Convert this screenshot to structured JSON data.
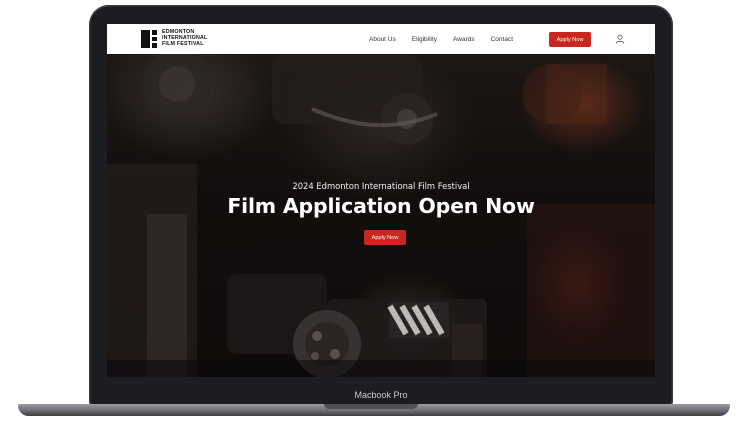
{
  "device": {
    "label": "Macbook Pro"
  },
  "site": {
    "logo": {
      "lines": [
        "EDMONTON",
        "INTERNATIONAL",
        "FILM FESTIVAL"
      ]
    },
    "nav": {
      "links": [
        "About Us",
        "Eligibility",
        "Awards",
        "Contact"
      ],
      "apply_label": "Apply Now",
      "user_icon": "user-icon"
    },
    "hero": {
      "subtitle": "2024 Edmonton International Film Festival",
      "title": "Film Application Open Now",
      "apply_label": "Apply Now"
    }
  },
  "colors": {
    "accent": "#c8281f",
    "nav_bg": "#ffffff",
    "laptop_frame": "#1c1d20"
  }
}
